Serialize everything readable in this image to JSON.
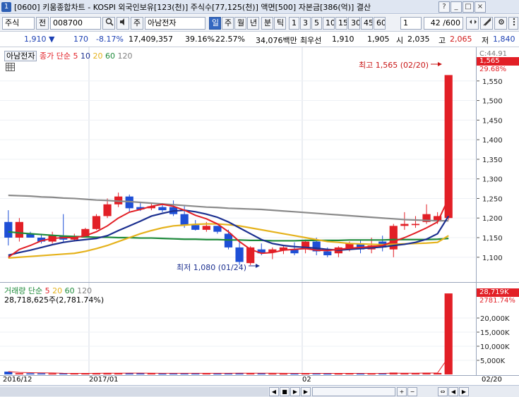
{
  "window": {
    "number": "1",
    "title": "[0600] 키움종합차트 - KOSPI 외국인보유[123(천)] 주식수[77,125(천)] 액면[500] 자본금[386(억)] 결산",
    "buttons": [
      "?",
      "_",
      "□",
      "×"
    ]
  },
  "toolbar": {
    "market": "주식",
    "market_btn": "전",
    "code": "008700",
    "name_prefix": "주",
    "name": "아남전자",
    "periods": [
      "일",
      "주",
      "월",
      "년",
      "분",
      "틱"
    ],
    "minutes": [
      "1",
      "3",
      "5",
      "10",
      "15",
      "30",
      "45",
      "60"
    ],
    "unit": "1",
    "count": "42 /600"
  },
  "quote": {
    "price": "1,910 ▼",
    "change": "170",
    "rate": "-8.17%",
    "volume": "17,409,357",
    "turnover": "39.16%",
    "foreign": "22.57%",
    "amount": "34,076백만",
    "prev_label": "최우선",
    "ask": "1,910",
    "bid": "1,905",
    "open_label": "시",
    "open": "2,035",
    "high_label": "고",
    "high": "2,065",
    "low_label": "저",
    "low": "1,840"
  },
  "price_pane": {
    "stock": "아남전자",
    "legend_label": "종가 단순",
    "ma_periods": [
      "5",
      "10",
      "20",
      "60",
      "120"
    ],
    "ma_colors": [
      "#e21f26",
      "#1b2f8f",
      "#e5b21c",
      "#1e8a3a",
      "#808080"
    ],
    "max_label": "최고 1,565 (02/20)",
    "min_label": "최저 1,080 (01/24)",
    "axis_top": "C:44.91",
    "axis_last": "1,565",
    "axis_change": "29.68%"
  },
  "volume_pane": {
    "legend_label": "거래량 단순",
    "ma_periods": [
      "5",
      "20",
      "60",
      "120"
    ],
    "current": "28,718,625주(2,781.74%)",
    "axis_last": "28,719K",
    "axis_rate": "2781.74%"
  },
  "date_axis": [
    "2016/12",
    "2017/01",
    "02",
    "02/20"
  ],
  "chart_data": [
    {
      "type": "candlestick",
      "title": "아남전자",
      "ylim": [
        1060,
        1600
      ],
      "y_ticks": [
        1100,
        1150,
        1200,
        1250,
        1300,
        1350,
        1400,
        1450,
        1500,
        1550
      ],
      "y_tick_labels": [
        "1,100",
        "1,150",
        "1,200",
        "1,250",
        "1,300",
        "1,350",
        "1,400",
        "1,450",
        "1,500",
        "1,550"
      ],
      "candles": [
        {
          "o": 1190,
          "h": 1220,
          "l": 1130,
          "c": 1150
        },
        {
          "o": 1150,
          "h": 1200,
          "l": 1140,
          "c": 1190
        },
        {
          "o": 1160,
          "h": 1165,
          "l": 1150,
          "c": 1150
        },
        {
          "o": 1150,
          "h": 1160,
          "l": 1135,
          "c": 1140
        },
        {
          "o": 1140,
          "h": 1165,
          "l": 1135,
          "c": 1155
        },
        {
          "o": 1155,
          "h": 1210,
          "l": 1140,
          "c": 1145
        },
        {
          "o": 1145,
          "h": 1160,
          "l": 1140,
          "c": 1150
        },
        {
          "o": 1150,
          "h": 1175,
          "l": 1150,
          "c": 1172
        },
        {
          "o": 1172,
          "h": 1210,
          "l": 1170,
          "c": 1205
        },
        {
          "o": 1205,
          "h": 1250,
          "l": 1200,
          "c": 1235
        },
        {
          "o": 1235,
          "h": 1265,
          "l": 1228,
          "c": 1255
        },
        {
          "o": 1255,
          "h": 1260,
          "l": 1215,
          "c": 1225
        },
        {
          "o": 1228,
          "h": 1240,
          "l": 1218,
          "c": 1222
        },
        {
          "o": 1225,
          "h": 1240,
          "l": 1220,
          "c": 1230
        },
        {
          "o": 1228,
          "h": 1238,
          "l": 1215,
          "c": 1220
        },
        {
          "o": 1228,
          "h": 1245,
          "l": 1205,
          "c": 1210
        },
        {
          "o": 1210,
          "h": 1230,
          "l": 1175,
          "c": 1183
        },
        {
          "o": 1182,
          "h": 1195,
          "l": 1168,
          "c": 1170
        },
        {
          "o": 1170,
          "h": 1190,
          "l": 1165,
          "c": 1180
        },
        {
          "o": 1180,
          "h": 1180,
          "l": 1160,
          "c": 1165
        },
        {
          "o": 1160,
          "h": 1170,
          "l": 1120,
          "c": 1125
        },
        {
          "o": 1125,
          "h": 1140,
          "l": 1080,
          "c": 1088
        },
        {
          "o": 1085,
          "h": 1128,
          "l": 1080,
          "c": 1125
        },
        {
          "o": 1120,
          "h": 1135,
          "l": 1105,
          "c": 1110
        },
        {
          "o": 1112,
          "h": 1125,
          "l": 1095,
          "c": 1120
        },
        {
          "o": 1118,
          "h": 1128,
          "l": 1108,
          "c": 1125
        },
        {
          "o": 1120,
          "h": 1138,
          "l": 1105,
          "c": 1110
        },
        {
          "o": 1120,
          "h": 1145,
          "l": 1110,
          "c": 1140
        },
        {
          "o": 1140,
          "h": 1150,
          "l": 1105,
          "c": 1115
        },
        {
          "o": 1115,
          "h": 1125,
          "l": 1100,
          "c": 1105
        },
        {
          "o": 1110,
          "h": 1128,
          "l": 1100,
          "c": 1125
        },
        {
          "o": 1120,
          "h": 1140,
          "l": 1115,
          "c": 1135
        },
        {
          "o": 1135,
          "h": 1145,
          "l": 1110,
          "c": 1120
        },
        {
          "o": 1120,
          "h": 1150,
          "l": 1110,
          "c": 1130
        },
        {
          "o": 1140,
          "h": 1155,
          "l": 1115,
          "c": 1125
        },
        {
          "o": 1120,
          "h": 1185,
          "l": 1100,
          "c": 1180
        },
        {
          "o": 1180,
          "h": 1215,
          "l": 1170,
          "c": 1185
        },
        {
          "o": 1182,
          "h": 1205,
          "l": 1175,
          "c": 1185
        },
        {
          "o": 1190,
          "h": 1235,
          "l": 1185,
          "c": 1210
        },
        {
          "o": 1195,
          "h": 1215,
          "l": 1185,
          "c": 1205
        },
        {
          "o": 1200,
          "h": 1565,
          "l": 1195,
          "c": 1565
        }
      ],
      "ma5": [
        1100,
        1120,
        1130,
        1142,
        1148,
        1150,
        1150,
        1155,
        1165,
        1180,
        1200,
        1215,
        1222,
        1230,
        1235,
        1230,
        1220,
        1207,
        1198,
        1185,
        1165,
        1140,
        1120,
        1110,
        1112,
        1118,
        1120,
        1122,
        1118,
        1117,
        1120,
        1123,
        1125,
        1127,
        1130,
        1140,
        1150,
        1162,
        1175,
        1190,
        1250
      ],
      "ma10": [
        1105,
        1112,
        1118,
        1125,
        1132,
        1138,
        1142,
        1145,
        1148,
        1155,
        1168,
        1180,
        1192,
        1205,
        1212,
        1218,
        1220,
        1216,
        1210,
        1202,
        1190,
        1175,
        1160,
        1145,
        1135,
        1130,
        1127,
        1125,
        1123,
        1120,
        1118,
        1120,
        1122,
        1124,
        1126,
        1130,
        1133,
        1138,
        1146,
        1160,
        1205
      ],
      "ma20": [
        1098,
        1100,
        1102,
        1104,
        1106,
        1108,
        1110,
        1115,
        1122,
        1130,
        1140,
        1150,
        1160,
        1168,
        1175,
        1180,
        1182,
        1184,
        1185,
        1185,
        1183,
        1180,
        1175,
        1170,
        1165,
        1160,
        1155,
        1150,
        1145,
        1140,
        1138,
        1135,
        1134,
        1133,
        1132,
        1133,
        1134,
        1135,
        1136,
        1138,
        1155
      ],
      "ma60": [
        1165,
        1162,
        1160,
        1158,
        1156,
        1154,
        1153,
        1152,
        1151,
        1151,
        1150,
        1150,
        1149,
        1149,
        1148,
        1147,
        1146,
        1146,
        1145,
        1145,
        1144,
        1144,
        1143,
        1143,
        1142,
        1142,
        1142,
        1143,
        1143,
        1143,
        1143,
        1144,
        1144,
        1144,
        1144,
        1145,
        1145,
        1145,
        1145,
        1146,
        1148
      ],
      "ma120": [
        1258,
        1257,
        1256,
        1254,
        1253,
        1251,
        1250,
        1248,
        1246,
        1245,
        1243,
        1242,
        1240,
        1238,
        1236,
        1234,
        1232,
        1230,
        1228,
        1227,
        1225,
        1224,
        1223,
        1222,
        1220,
        1218,
        1216,
        1214,
        1212,
        1210,
        1208,
        1206,
        1204,
        1202,
        1200,
        1198,
        1196,
        1195,
        1194,
        1193,
        1193
      ]
    },
    {
      "type": "bar",
      "title": "거래량",
      "y_tick_labels": [
        "20,000K",
        "15,000K",
        "10,000K",
        "5,000K"
      ],
      "y_ticks": [
        20000,
        15000,
        10000,
        5000
      ],
      "ylim": [
        0,
        30000
      ],
      "values": [
        1000,
        450,
        400,
        380,
        350,
        420,
        380,
        360,
        500,
        520,
        480,
        420,
        400,
        380,
        350,
        420,
        480,
        400,
        380,
        360,
        450,
        520,
        420,
        380,
        350,
        330,
        360,
        400,
        380,
        350,
        340,
        380,
        360,
        350,
        400,
        650,
        420,
        400,
        600,
        520,
        28719
      ]
    }
  ]
}
